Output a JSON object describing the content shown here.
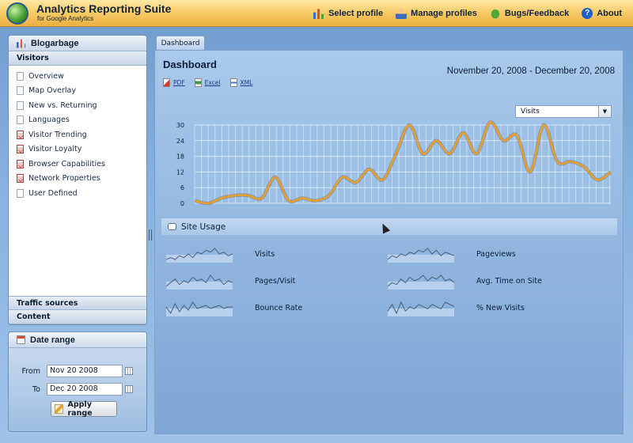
{
  "app": {
    "title": "Analytics Reporting Suite",
    "subtitle": "for Google Analytics",
    "nav": [
      {
        "label": "Select profile",
        "icon": "chart-icon"
      },
      {
        "label": "Manage profiles",
        "icon": "user-icon"
      },
      {
        "label": "Bugs/Feedback",
        "icon": "bug-icon"
      },
      {
        "label": "About",
        "icon": "help-icon"
      }
    ]
  },
  "sidebar": {
    "profile": "Blogarbage",
    "visitors_section": "Visitors",
    "items": [
      {
        "label": "Overview",
        "icon": "doc"
      },
      {
        "label": "Map Overlay",
        "icon": "doc"
      },
      {
        "label": "New vs. Returning",
        "icon": "doc"
      },
      {
        "label": "Languages",
        "icon": "doc"
      },
      {
        "label": "Visitor Trending",
        "icon": "report"
      },
      {
        "label": "Visitor Loyalty",
        "icon": "report"
      },
      {
        "label": "Browser Capabilities",
        "icon": "report"
      },
      {
        "label": "Network Properties",
        "icon": "report"
      },
      {
        "label": "User Defined",
        "icon": "doc"
      }
    ],
    "sections": [
      "Traffic sources",
      "Content"
    ]
  },
  "date_range": {
    "title": "Date range",
    "from_label": "From",
    "from_value": "Nov 20 2008",
    "to_label": "To",
    "to_value": "Dec 20 2008",
    "apply_label": "Apply range"
  },
  "dashboard": {
    "tab": "Dashboard",
    "title": "Dashboard",
    "range": "November 20, 2008 - December 20, 2008",
    "exports": [
      "PDF",
      "Excel",
      "XML"
    ],
    "metric_select": "Visits",
    "site_usage_title": "Site Usage",
    "metrics": [
      {
        "label": "Visits",
        "spark": [
          3,
          4,
          3,
          5,
          4,
          6,
          4,
          7,
          6,
          8,
          7,
          9,
          6,
          7,
          5,
          6
        ]
      },
      {
        "label": "Pageviews",
        "spark": [
          3,
          5,
          4,
          6,
          5,
          7,
          6,
          8,
          7,
          9,
          6,
          8,
          5,
          7,
          6,
          5
        ]
      },
      {
        "label": "Pages/Visit",
        "spark": [
          3,
          5,
          7,
          4,
          6,
          5,
          8,
          6,
          7,
          5,
          9,
          6,
          7,
          4,
          6,
          5
        ]
      },
      {
        "label": "Avg. Time on Site",
        "spark": [
          2,
          4,
          3,
          6,
          4,
          7,
          5,
          6,
          8,
          5,
          7,
          6,
          8,
          5,
          6,
          4
        ]
      },
      {
        "label": "Bounce Rate",
        "spark": [
          6,
          2,
          8,
          3,
          7,
          4,
          9,
          5,
          6,
          7,
          5,
          6,
          7,
          5,
          6,
          6
        ]
      },
      {
        "label": "% New Visits",
        "spark": [
          4,
          7,
          3,
          8,
          4,
          6,
          5,
          7,
          6,
          5,
          7,
          6,
          5,
          8,
          7,
          6
        ]
      }
    ]
  },
  "colors": {
    "line": "#e8a02a",
    "accent": "#f6c75f"
  },
  "chart_data": {
    "type": "line",
    "series": [
      {
        "values": [
          1,
          0,
          2,
          3,
          3,
          2,
          10,
          1,
          2,
          1,
          3,
          10,
          8,
          13,
          9,
          19,
          30,
          19,
          24,
          19,
          27,
          19,
          31,
          24,
          26,
          12,
          30,
          16,
          16,
          14,
          9,
          12
        ]
      }
    ],
    "ylim": [
      0,
      30
    ],
    "yticks": [
      0,
      6,
      12,
      18,
      24,
      30
    ],
    "grid": true
  }
}
